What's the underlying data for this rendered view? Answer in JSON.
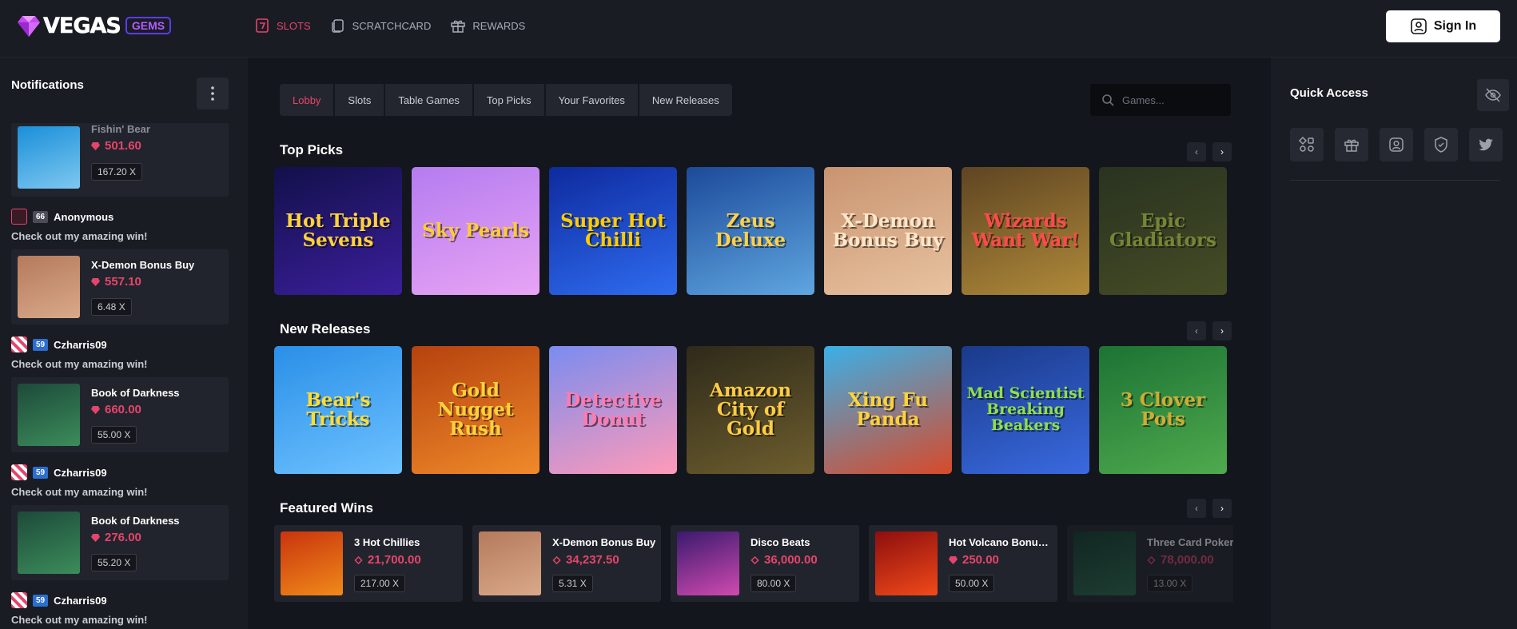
{
  "header": {
    "logo_text": "VEGAS",
    "logo_badge": "GEMS",
    "nav": [
      {
        "label": "SLOTS",
        "icon": "slot-seven-icon",
        "active": true
      },
      {
        "label": "SCRATCHCARD",
        "icon": "scratchcard-icon",
        "active": false
      },
      {
        "label": "REWARDS",
        "icon": "gift-icon",
        "active": false
      }
    ],
    "signin_label": "Sign In"
  },
  "notifications": {
    "title": "Notifications",
    "feed": [
      {
        "game": "Fishin' Bear",
        "amount": "501.60",
        "multiplier": "167.20 X",
        "thumb_colors": [
          "#1a8fd9",
          "#7ec8f0"
        ]
      },
      {
        "user": "Anonymous",
        "level": "66",
        "message": "Check out my amazing win!",
        "game": "X-Demon Bonus Buy",
        "amount": "557.10",
        "multiplier": "6.48 X",
        "thumb_colors": [
          "#b57a5c",
          "#d9a98a"
        ]
      },
      {
        "user": "Czharris09",
        "level": "59",
        "message": "Check out my amazing win!",
        "game": "Book of Darkness",
        "amount": "660.00",
        "multiplier": "55.00 X",
        "thumb_colors": [
          "#1d4a3a",
          "#3c8c5a"
        ]
      },
      {
        "user": "Czharris09",
        "level": "59",
        "message": "Check out my amazing win!",
        "game": "Book of Darkness",
        "amount": "276.00",
        "multiplier": "55.20 X",
        "thumb_colors": [
          "#1d4a3a",
          "#3c8c5a"
        ]
      },
      {
        "user": "Czharris09",
        "level": "59",
        "message": "Check out my amazing win!"
      }
    ]
  },
  "main": {
    "tabs": [
      {
        "label": "Lobby",
        "active": true
      },
      {
        "label": "Slots",
        "active": false
      },
      {
        "label": "Table Games",
        "active": false
      },
      {
        "label": "Top Picks",
        "active": false
      },
      {
        "label": "Your Favorites",
        "active": false
      },
      {
        "label": "New Releases",
        "active": false
      }
    ],
    "search_placeholder": "Games...",
    "top_picks": {
      "title": "Top Picks",
      "games": [
        {
          "name": "Hot Triple Sevens",
          "text_color": "#ffd23a",
          "bg": [
            "#12104a",
            "#3b1f9c"
          ]
        },
        {
          "name": "Sky Pearls",
          "text_color": "#ffcc33",
          "bg": [
            "#b57cf0",
            "#e8a4f4"
          ]
        },
        {
          "name": "Super Hot Chilli",
          "text_color": "#ffcc00",
          "bg": [
            "#0e2a9e",
            "#2f6cf0"
          ]
        },
        {
          "name": "Zeus Deluxe",
          "text_color": "#ffd14a",
          "bg": [
            "#1c4a9a",
            "#5fa6e0"
          ]
        },
        {
          "name": "X-Demon Bonus Buy",
          "text_color": "#ffe7c8",
          "bg": [
            "#c99470",
            "#e8c2a0"
          ]
        },
        {
          "name": "Wizards Want War!",
          "text_color": "#ff4a4a",
          "bg": [
            "#5e4522",
            "#b08a3a"
          ]
        },
        {
          "name": "Epic Gladiators",
          "text_color": "#c5e04a",
          "bg": [
            "#3a4a22",
            "#6e7a2e"
          ]
        }
      ]
    },
    "new_releases": {
      "title": "New Releases",
      "games": [
        {
          "name": "Bear's Tricks",
          "text_color": "#ffdd33",
          "bg": [
            "#2a8fe8",
            "#6ec2ff"
          ]
        },
        {
          "name": "Gold Nugget Rush",
          "text_color": "#ffd23a",
          "bg": [
            "#b5420e",
            "#f08a2a"
          ]
        },
        {
          "name": "Detective Donut",
          "text_color": "#ff7ab0",
          "bg": [
            "#7a8cf0",
            "#ff9ab8"
          ]
        },
        {
          "name": "Amazon City of Gold",
          "text_color": "#ffcc44",
          "bg": [
            "#2e2a1a",
            "#6e5e2e"
          ]
        },
        {
          "name": "Xing Fu Panda",
          "text_color": "#ffd23a",
          "bg": [
            "#3ab0e8",
            "#d84a2a"
          ]
        },
        {
          "name": "Mad Scientist Breaking Beakers",
          "text_color": "#8ee04a",
          "bg": [
            "#1a3a8a",
            "#3a6ae0"
          ]
        },
        {
          "name": "3 Clover Pots",
          "text_color": "#ffd23a",
          "bg": [
            "#1e8a3a",
            "#5ed05a"
          ]
        }
      ]
    },
    "featured_wins": {
      "title": "Featured Wins",
      "wins": [
        {
          "game": "3 Hot Chillies",
          "amount": "21,700.00",
          "multiplier": "217.00 X",
          "thumb_colors": [
            "#c9340e",
            "#f08a1a"
          ]
        },
        {
          "game": "X-Demon Bonus Buy",
          "amount": "34,237.50",
          "multiplier": "5.31 X",
          "thumb_colors": [
            "#b57a5c",
            "#d9a98a"
          ]
        },
        {
          "game": "Disco Beats",
          "amount": "36,000.00",
          "multiplier": "80.00 X",
          "thumb_colors": [
            "#3a1a6e",
            "#d04ab0"
          ]
        },
        {
          "game": "Hot Volcano Bonus Buy",
          "amount": "250.00",
          "multiplier": "50.00 X",
          "thumb_colors": [
            "#8e0e0e",
            "#f04a1a"
          ]
        },
        {
          "game": "Three Card Poker",
          "amount": "78,000.00",
          "multiplier": "13.00 X",
          "thumb_colors": [
            "#0e3a2a",
            "#2a6e4a"
          ]
        }
      ]
    }
  },
  "quick_access": {
    "title": "Quick Access",
    "icons": [
      "apps-icon",
      "gift-icon",
      "profile-icon",
      "shield-icon",
      "twitter-icon"
    ]
  },
  "colors": {
    "accent": "#e5456a",
    "panel": "#1a1c24",
    "background": "#14161d"
  }
}
